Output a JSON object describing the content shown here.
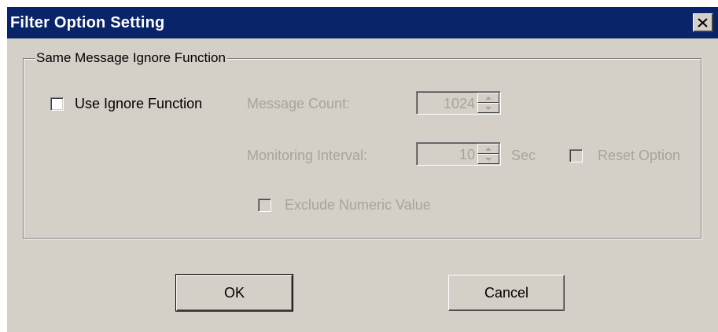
{
  "window": {
    "title": "Filter Option Setting",
    "close_icon": "close-x-icon"
  },
  "group": {
    "label": "Same Message Ignore Function"
  },
  "ignore": {
    "label": "Use Ignore Function",
    "checked": false
  },
  "message_count": {
    "label": "Message Count:",
    "value": "1024"
  },
  "monitoring_interval": {
    "label": "Monitoring Interval:",
    "value": "10",
    "unit": "Sec"
  },
  "reset_option": {
    "label": "Reset Option",
    "checked": false
  },
  "exclude_numeric": {
    "label": "Exclude Numeric Value",
    "checked": false
  },
  "buttons": {
    "ok": "OK",
    "cancel": "Cancel"
  },
  "colors": {
    "title_bar": "#0a246a",
    "face": "#d4d0c8",
    "disabled_text": "#a8a49c"
  }
}
